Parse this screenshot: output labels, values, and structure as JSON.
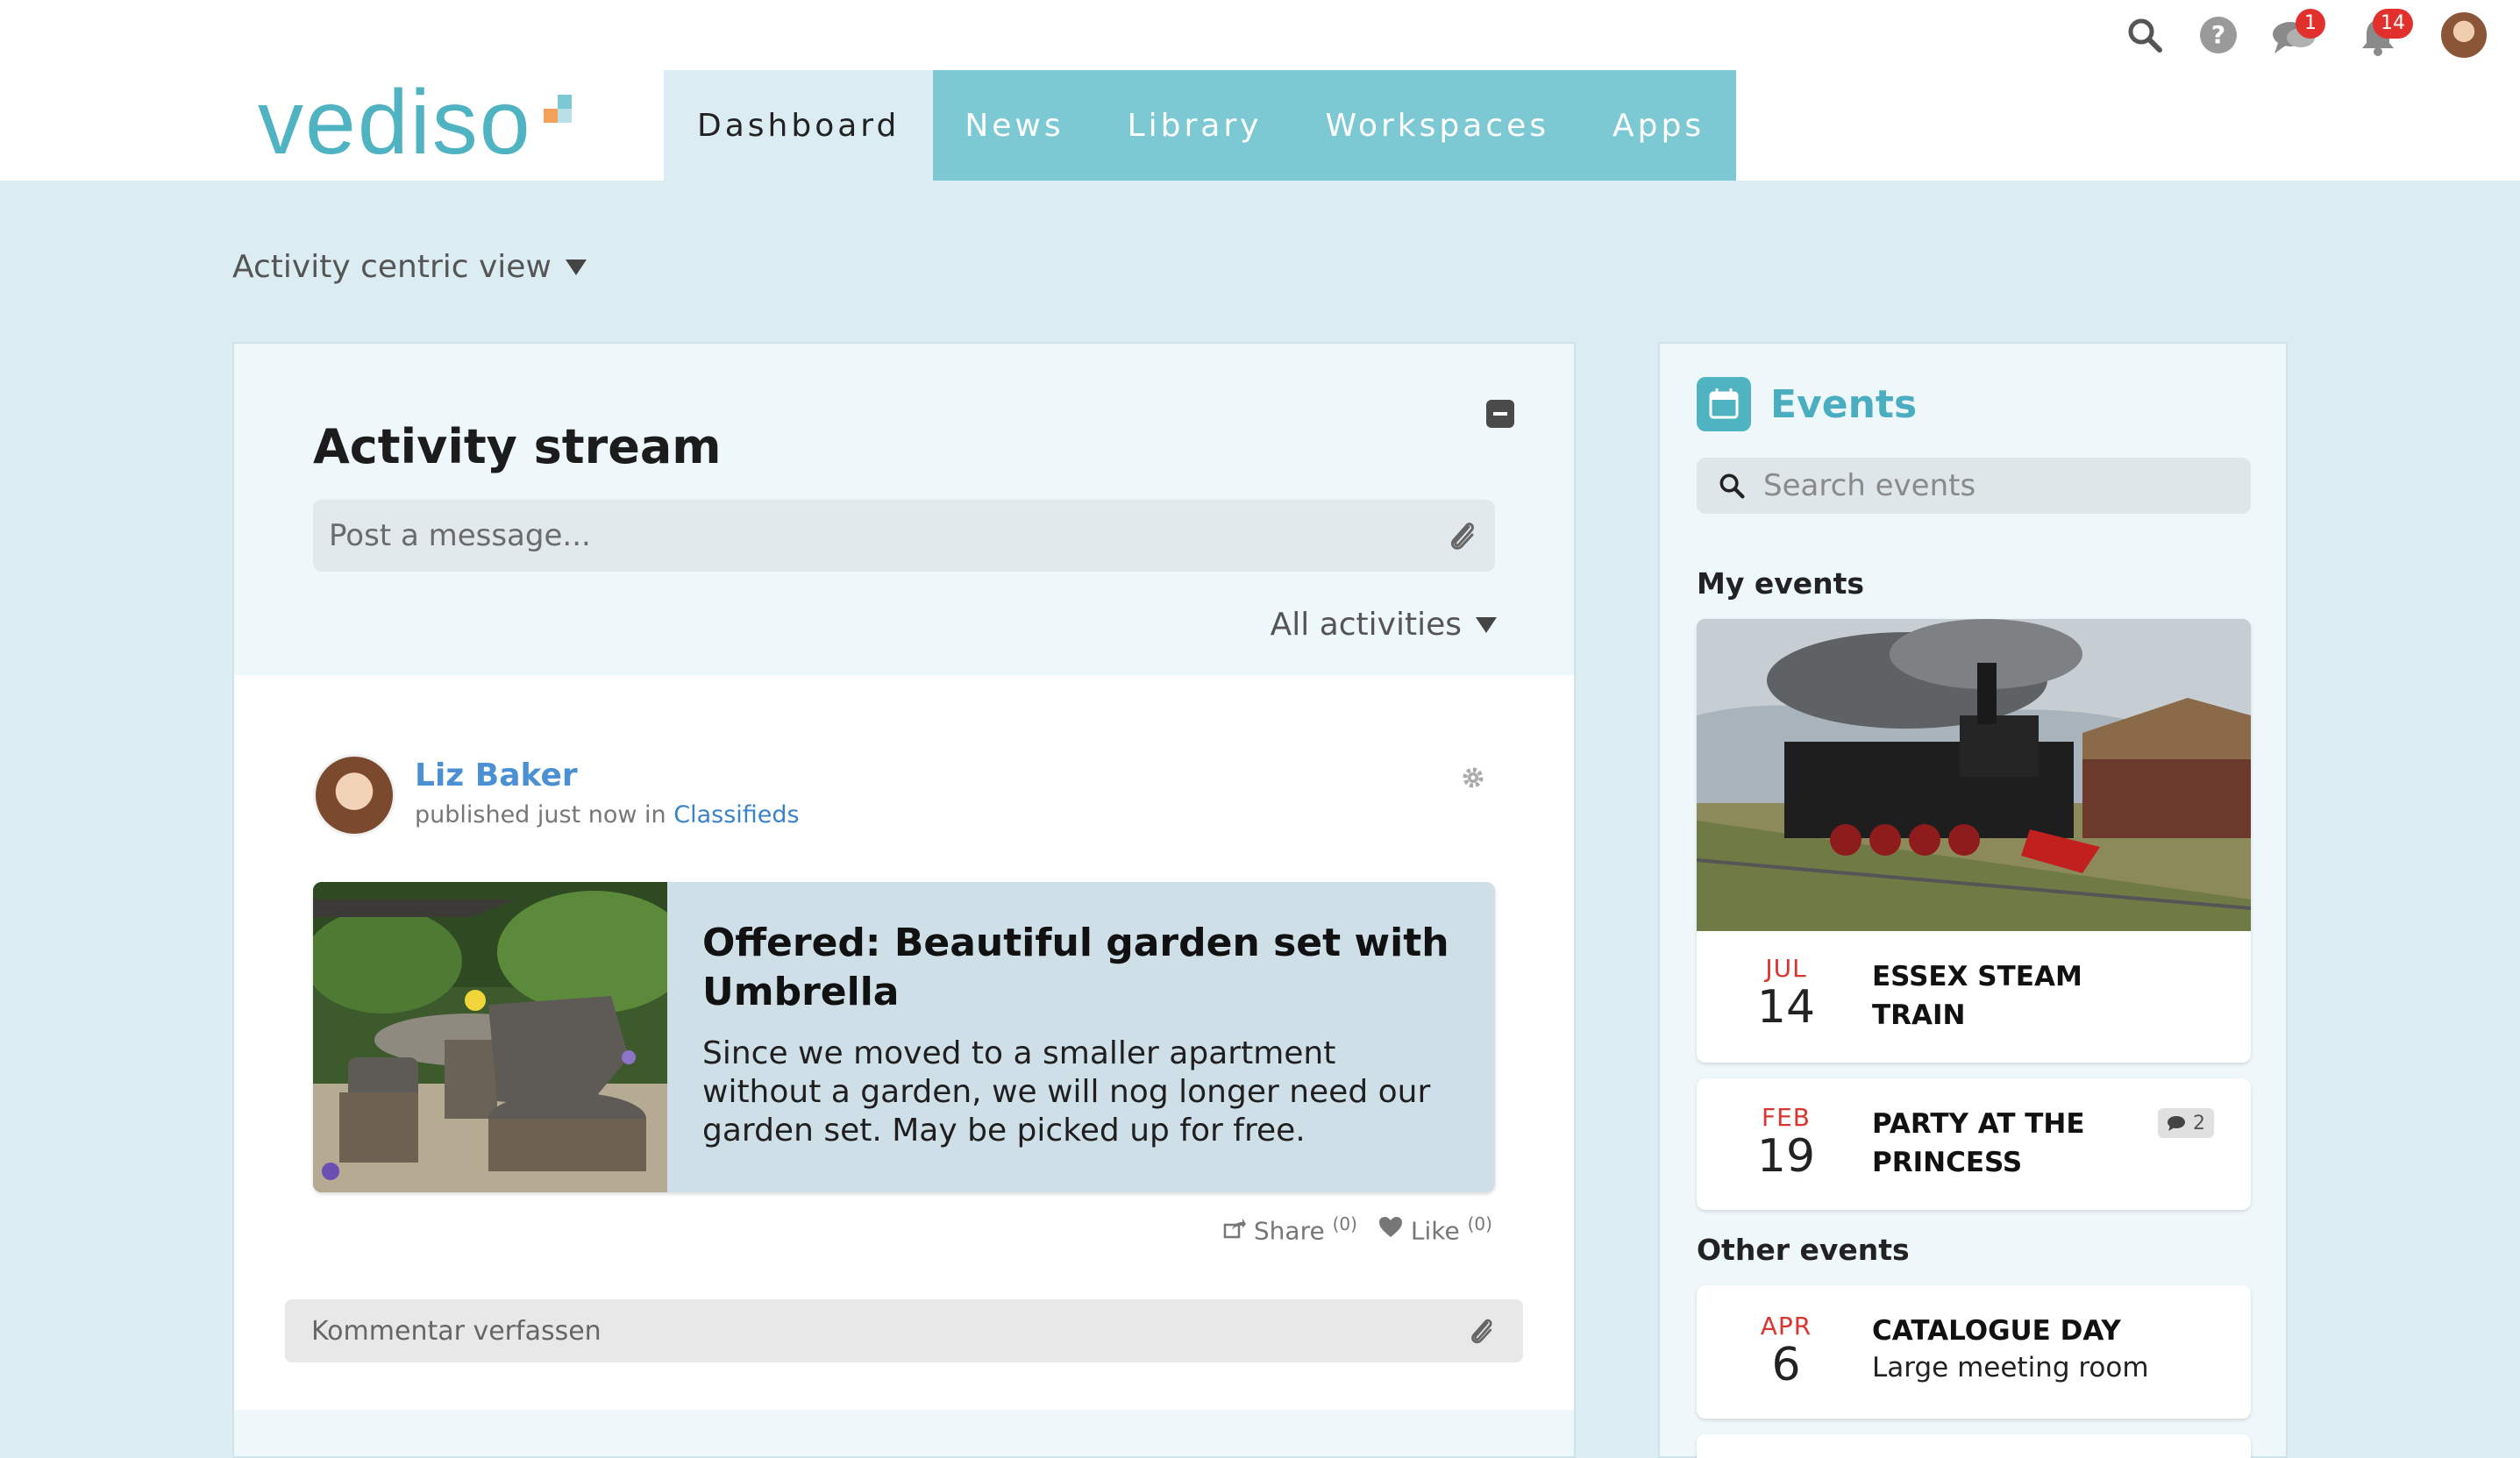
{
  "header": {
    "logo_text": "vediso",
    "nav_tabs": [
      {
        "label": "Dashboard",
        "active": true
      },
      {
        "label": "News",
        "active": false
      },
      {
        "label": "Library",
        "active": false
      },
      {
        "label": "Workspaces",
        "active": false
      },
      {
        "label": "Apps",
        "active": false
      }
    ],
    "icons": {
      "search": "search-icon",
      "help": "help-icon",
      "chat": "chat-icon",
      "notifications": "bell-icon"
    },
    "chat_badge": "1",
    "notification_badge": "14",
    "accent_color": "#4fb3c2",
    "badge_color": "#e2312d"
  },
  "view_selector": {
    "label": "Activity centric view"
  },
  "activity": {
    "title": "Activity stream",
    "post_placeholder": "Post a message...",
    "filter_label": "All activities",
    "post": {
      "author": "Liz Baker",
      "meta_prefix": "published just now in",
      "place": "Classifieds",
      "item_title": "Offered: Beautiful garden set with Umbrella",
      "item_description": "Since we moved to a smaller apartment without a garden, we will nog longer need our garden set. May be picked up for free.",
      "share_label": "Share",
      "share_count": "(0)",
      "like_label": "Like",
      "like_count": "(0)",
      "comment_placeholder": "Kommentar verfassen"
    }
  },
  "events": {
    "title": "Events",
    "search_placeholder": "Search events",
    "my_events_label": "My events",
    "other_events_label": "Other events",
    "my_events": [
      {
        "month": "JUL",
        "day": "14",
        "name": "ESSEX STEAM TRAIN"
      },
      {
        "month": "FEB",
        "day": "19",
        "name": "PARTY AT THE PRINCESS",
        "comments": "2"
      }
    ],
    "other_events": [
      {
        "month": "APR",
        "day": "6",
        "name": "CATALOGUE DAY",
        "location": "Large meeting room"
      }
    ]
  }
}
